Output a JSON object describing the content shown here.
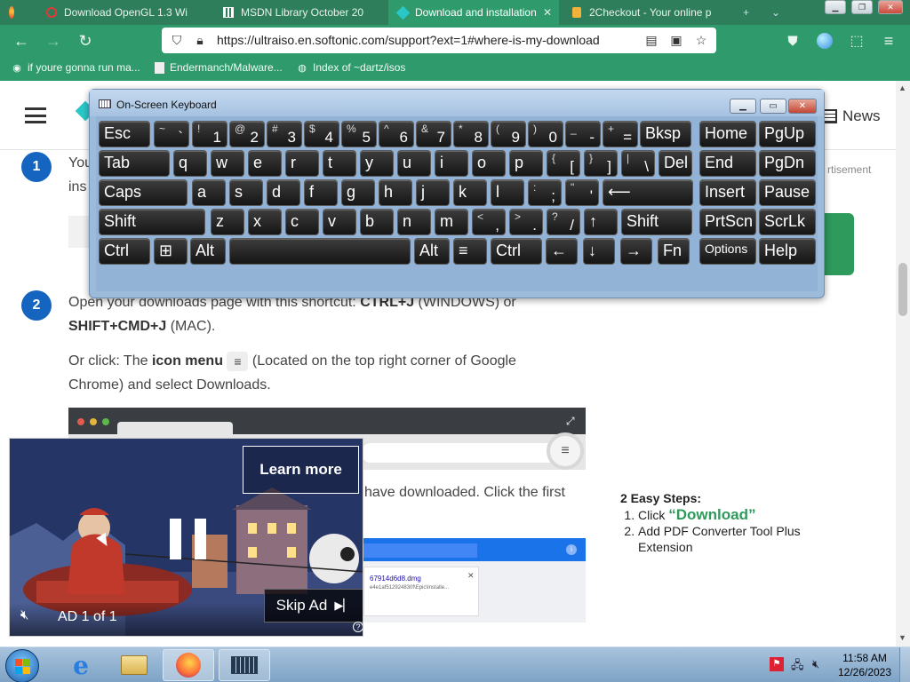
{
  "tabs": [
    {
      "title": "Download OpenGL 1.3 Wi",
      "icon": "opera-icon"
    },
    {
      "title": "MSDN Library October 20",
      "icon": "archive-icon"
    },
    {
      "title": "Download and installation",
      "icon": "softonic-icon",
      "active": true
    },
    {
      "title": "2Checkout - Your online p",
      "icon": "2checkout-icon"
    }
  ],
  "address_bar": {
    "url": "https://ultraiso.en.softonic.com/support?ext=1#where-is-my-download"
  },
  "bookmarks": [
    {
      "label": "if youre gonna run ma..."
    },
    {
      "label": "Endermanch/Malware..."
    },
    {
      "label": "Index of ~dartz/isos"
    }
  ],
  "site_header": {
    "news_label": "News"
  },
  "page": {
    "step1_number": "1",
    "step1_text_a": "You",
    "step1_text_b": "ins",
    "advertisement_label": "rtisement",
    "step2_number": "2",
    "step2_line1_pre": "Open your downloads page with this shortcut: ",
    "step2_line1_bold": "CTRL+J",
    "step2_line1_post": " (WINDOWS) or",
    "step2_line2_bold": "SHIFT+CMD+J",
    "step2_line2_post": " (MAC).",
    "or_click_pre": "Or click:  The ",
    "or_click_bold": "icon menu",
    "or_click_post": " (Located on the top right corner of Google",
    "or_click_line2": "Chrome) and select Downloads.",
    "step3_text": "have downloaded. Click the first",
    "download_filename": "67914d6d8.dmg",
    "download_hash": "e4e1af512924830f\\Epic\\Installe..."
  },
  "sidebar_ad": {
    "title": "2 Easy Steps:",
    "steps": [
      {
        "prefix": "Click ",
        "link": "“Download”"
      },
      {
        "prefix": "Add PDF Converter Tool Plus Extension",
        "link": ""
      }
    ]
  },
  "video_ad": {
    "learn_more": "Learn more",
    "ad_counter": "AD 1 of 1",
    "skip_ad": "Skip Ad"
  },
  "osk": {
    "title": "On-Screen Keyboard",
    "rows": [
      [
        {
          "label": "Esc"
        },
        {
          "top": "~",
          "bottom": "`"
        },
        {
          "top": "!",
          "bottom": "1"
        },
        {
          "top": "@",
          "bottom": "2"
        },
        {
          "top": "#",
          "bottom": "3"
        },
        {
          "top": "$",
          "bottom": "4"
        },
        {
          "top": "%",
          "bottom": "5"
        },
        {
          "top": "^",
          "bottom": "6"
        },
        {
          "top": "&",
          "bottom": "7"
        },
        {
          "top": "*",
          "bottom": "8"
        },
        {
          "top": "(",
          "bottom": "9"
        },
        {
          "top": ")",
          "bottom": "0"
        },
        {
          "top": "_",
          "bottom": "-"
        },
        {
          "top": "+",
          "bottom": "="
        },
        {
          "label": "Bksp"
        },
        {
          "label": "Home"
        },
        {
          "label": "PgUp"
        }
      ],
      [
        {
          "label": "Tab"
        },
        {
          "label": "q"
        },
        {
          "label": "w"
        },
        {
          "label": "e"
        },
        {
          "label": "r"
        },
        {
          "label": "t"
        },
        {
          "label": "y"
        },
        {
          "label": "u"
        },
        {
          "label": "i"
        },
        {
          "label": "o"
        },
        {
          "label": "p"
        },
        {
          "top": "{",
          "bottom": "["
        },
        {
          "top": "}",
          "bottom": "]"
        },
        {
          "top": "|",
          "bottom": "\\"
        },
        {
          "label": "Del"
        },
        {
          "label": "End"
        },
        {
          "label": "PgDn"
        }
      ],
      [
        {
          "label": "Caps"
        },
        {
          "label": "a"
        },
        {
          "label": "s"
        },
        {
          "label": "d"
        },
        {
          "label": "f"
        },
        {
          "label": "g"
        },
        {
          "label": "h"
        },
        {
          "label": "j"
        },
        {
          "label": "k"
        },
        {
          "label": "l"
        },
        {
          "top": ":",
          "bottom": ";"
        },
        {
          "top": "\"",
          "bottom": "'"
        },
        {
          "label": "⟵"
        },
        {
          "label": "Insert"
        },
        {
          "label": "Pause"
        }
      ],
      [
        {
          "label": "Shift"
        },
        {
          "label": "z"
        },
        {
          "label": "x"
        },
        {
          "label": "c"
        },
        {
          "label": "v"
        },
        {
          "label": "b"
        },
        {
          "label": "n"
        },
        {
          "label": "m"
        },
        {
          "top": "<",
          "bottom": ","
        },
        {
          "top": ">",
          "bottom": "."
        },
        {
          "top": "?",
          "bottom": "/"
        },
        {
          "label": "↑"
        },
        {
          "label": "Shift"
        },
        {
          "label": "PrtScn"
        },
        {
          "label": "ScrLk"
        }
      ],
      [
        {
          "label": "Ctrl"
        },
        {
          "label": "⊞"
        },
        {
          "label": "Alt"
        },
        {
          "label": ""
        },
        {
          "label": "Alt"
        },
        {
          "label": "≡"
        },
        {
          "label": "Ctrl"
        },
        {
          "label": "←"
        },
        {
          "label": "↓"
        },
        {
          "label": "→"
        },
        {
          "label": "Fn"
        },
        {
          "label": "Options"
        },
        {
          "label": "Help"
        }
      ]
    ]
  },
  "taskbar": {
    "time": "11:58 AM",
    "date": "12/26/2023"
  },
  "colors": {
    "browser_green": "#2f9a6c",
    "step_blue": "#1565c0",
    "cta_green": "#2e9a5c"
  }
}
